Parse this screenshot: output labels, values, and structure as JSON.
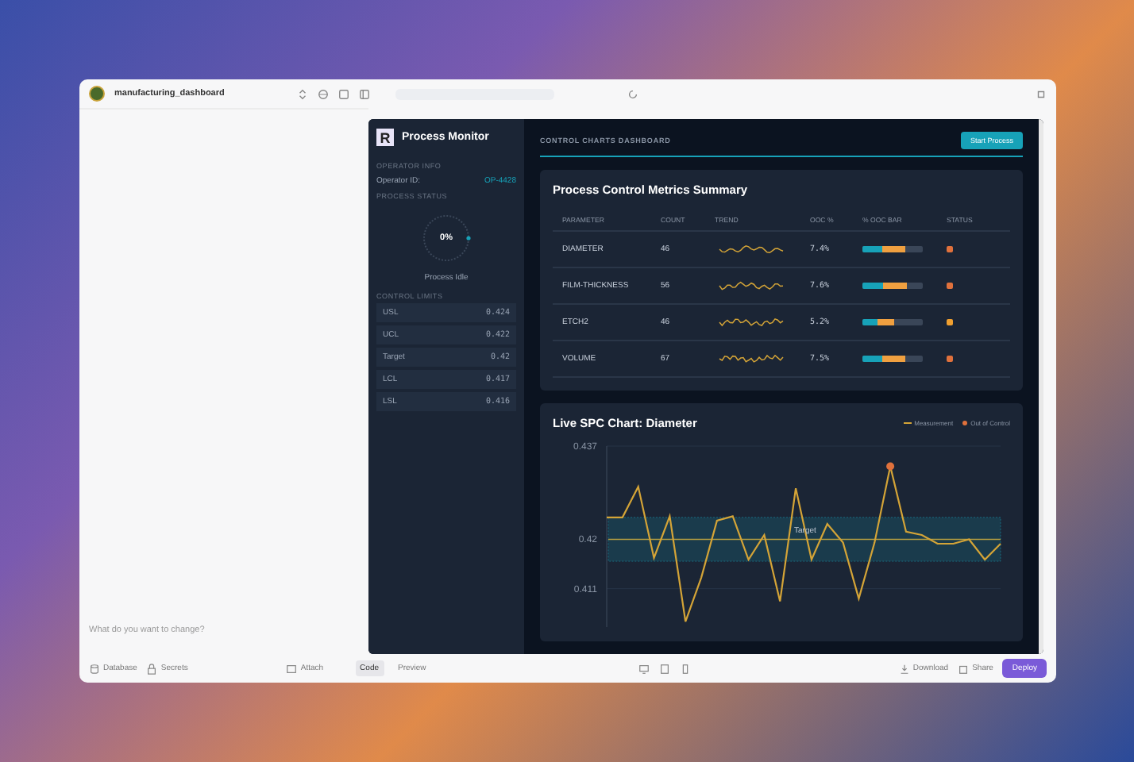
{
  "app_bar": {
    "project_name": "manufacturing_dashboard"
  },
  "chat": {
    "placeholder": "What do you want to change?"
  },
  "preview": {
    "sidebar": {
      "title": "Process Monitor",
      "logo_letter": "R",
      "operator_heading": "OPERATOR INFO",
      "operator_label": "Operator ID:",
      "operator_value": "OP-4428",
      "status_heading": "PROCESS STATUS",
      "progress": {
        "level": 0,
        "reading": "0%"
      },
      "status_text": "Process Idle",
      "limits_heading": "CONTROL LIMITS",
      "limits": [
        {
          "label": "USL",
          "value": "0.424"
        },
        {
          "label": "UCL",
          "value": "0.422"
        },
        {
          "label": "Target",
          "value": "0.42"
        },
        {
          "label": "LCL",
          "value": "0.417"
        },
        {
          "label": "LSL",
          "value": "0.416"
        }
      ]
    },
    "header": {
      "title": "CONTROL CHARTS DASHBOARD",
      "button": "Start Process"
    },
    "summary": {
      "title": "Process Control Metrics Summary",
      "columns": [
        "PARAMETER",
        "COUNT",
        "TREND",
        "OOC %",
        "% OOC BAR",
        "STATUS"
      ],
      "rows": [
        {
          "parameter": "DIAMETER",
          "count": "46",
          "ooc": "7.4%",
          "level": 0.7,
          "color": "#e0713c"
        },
        {
          "parameter": "FILM-THICKNESS",
          "count": "56",
          "ooc": "7.6%",
          "level": 0.73,
          "color": "#e0713c"
        },
        {
          "parameter": "ETCH2",
          "count": "46",
          "ooc": "5.2%",
          "level": 0.53,
          "color": "#f0a030"
        },
        {
          "parameter": "VOLUME",
          "count": "67",
          "ooc": "7.5%",
          "level": 0.7,
          "color": "#e0713c"
        }
      ]
    },
    "spc": {
      "title": "Live SPC Chart: Diameter",
      "chart_data": {
        "type": "line",
        "ylim": [
          0.404,
          0.437
        ],
        "yticks": [
          0.411,
          0.42,
          0.437
        ],
        "series": [
          {
            "name": "Measurement",
            "color": "#d4a437",
            "values": [
              0.424,
              0.424,
              0.4296,
              0.4166,
              0.4242,
              0.405,
              0.413,
              0.4234,
              0.4242,
              0.4163,
              0.4208,
              0.4087,
              0.4293,
              0.4163,
              0.4228,
              0.4194,
              0.4092,
              0.4194,
              0.4333,
              0.4214,
              0.4208,
              0.4192,
              0.4192,
              0.42,
              0.4163,
              0.4192
            ]
          },
          {
            "name": "Out of Control",
            "color": "#e0713c",
            "marker": "circle",
            "values": [
              null,
              null,
              null,
              null,
              null,
              null,
              null,
              null,
              null,
              null,
              null,
              null,
              null,
              null,
              null,
              null,
              null,
              null,
              0.4333,
              null,
              null,
              null,
              null,
              null,
              null,
              null
            ]
          }
        ],
        "ref_lines": [
          {
            "axis": "y",
            "value": 0.42,
            "label": "Target",
            "color": "#b8a040"
          }
        ]
      }
    }
  },
  "bottom_bar": {
    "left": [
      "Database",
      "Secrets"
    ],
    "attach": "Attach",
    "tabs": [
      {
        "label": "Code",
        "selected": true
      },
      {
        "label": "Preview",
        "selected": false
      }
    ],
    "right": [
      "Download",
      "Share"
    ],
    "deploy": "Deploy"
  }
}
